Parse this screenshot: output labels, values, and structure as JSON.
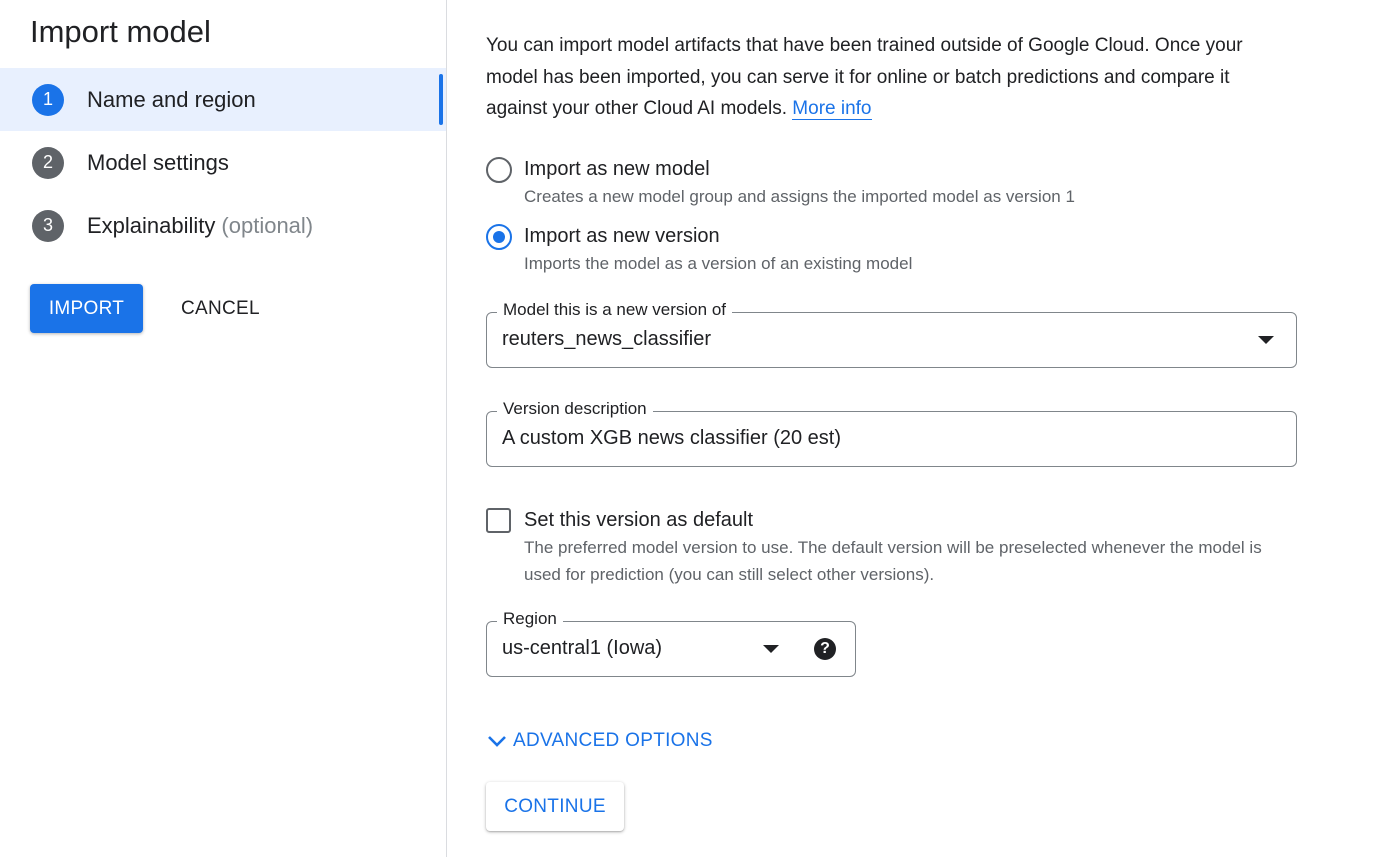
{
  "page": {
    "title": "Import model"
  },
  "steps": [
    {
      "number": "1",
      "label": "Name and region",
      "suffix": ""
    },
    {
      "number": "2",
      "label": "Model settings",
      "suffix": ""
    },
    {
      "number": "3",
      "label": "Explainability",
      "suffix": "(optional)"
    }
  ],
  "actions": {
    "import_label": "IMPORT",
    "cancel_label": "CANCEL"
  },
  "intro": {
    "text": "You can import model artifacts that have been trained outside of Google Cloud. Once your model has been imported, you can serve it for online or batch predictions and compare it against your other Cloud AI models.",
    "link": "More info"
  },
  "import_options": [
    {
      "label": "Import as new model",
      "description": "Creates a new model group and assigns the imported model as version 1",
      "checked": false
    },
    {
      "label": "Import as new version",
      "description": "Imports the model as a version of an existing model",
      "checked": true
    }
  ],
  "model_field": {
    "label": "Model this is a new version of",
    "value": "reuters_news_classifier"
  },
  "version_field": {
    "label": "Version description",
    "value": "A custom XGB news classifier (20 est)"
  },
  "default_checkbox": {
    "label": "Set this version as default",
    "description": "The preferred model version to use. The default version will be preselected whenever the model is used for prediction (you can still select other versions).",
    "checked": false
  },
  "region_field": {
    "label": "Region",
    "value": "us-central1 (Iowa)",
    "help": "?"
  },
  "advanced_label": "ADVANCED OPTIONS",
  "continue_label": "CONTINUE",
  "colors": {
    "accent": "#1a73e8",
    "active_step_bg": "#e8f0fe",
    "step_badge": "#5f6368"
  },
  "icons": {
    "radio": "radio-icon",
    "checkbox": "checkbox-icon",
    "dropdown": "caret-down-icon",
    "help": "help-icon",
    "expand": "chevron-down-icon"
  }
}
